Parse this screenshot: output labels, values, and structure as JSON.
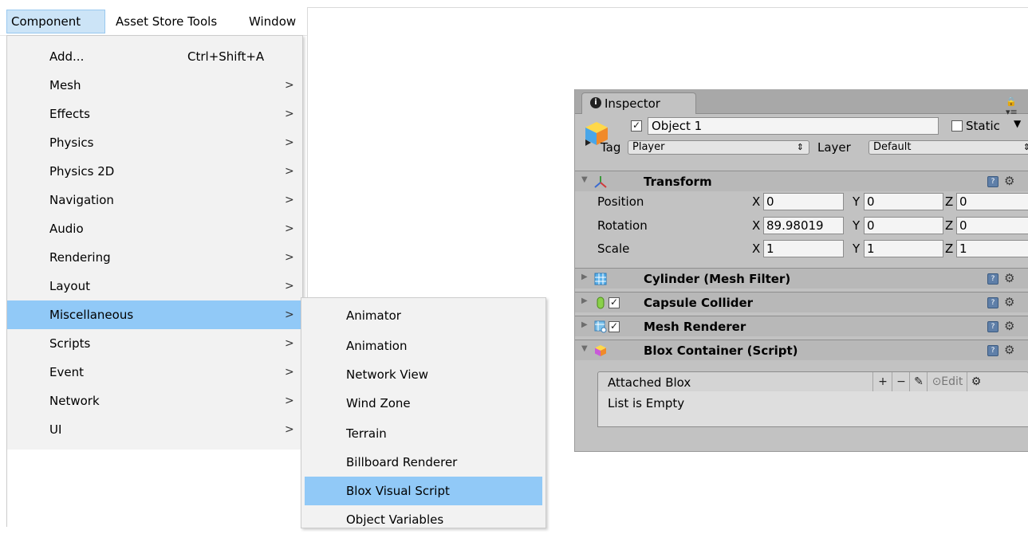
{
  "menubar": {
    "items": [
      "Component",
      "Asset Store Tools",
      "Window"
    ]
  },
  "component_menu": {
    "items": [
      {
        "label": "Add...",
        "shortcut": "Ctrl+Shift+A",
        "arrow": ""
      },
      {
        "label": "Mesh",
        "shortcut": "",
        "arrow": ">"
      },
      {
        "label": "Effects",
        "shortcut": "",
        "arrow": ">"
      },
      {
        "label": "Physics",
        "shortcut": "",
        "arrow": ">"
      },
      {
        "label": "Physics 2D",
        "shortcut": "",
        "arrow": ">"
      },
      {
        "label": "Navigation",
        "shortcut": "",
        "arrow": ">"
      },
      {
        "label": "Audio",
        "shortcut": "",
        "arrow": ">"
      },
      {
        "label": "Rendering",
        "shortcut": "",
        "arrow": ">"
      },
      {
        "label": "Layout",
        "shortcut": "",
        "arrow": ">"
      },
      {
        "label": "Miscellaneous",
        "shortcut": "",
        "arrow": ">"
      },
      {
        "label": "Scripts",
        "shortcut": "",
        "arrow": ">"
      },
      {
        "label": "Event",
        "shortcut": "",
        "arrow": ">"
      },
      {
        "label": "Network",
        "shortcut": "",
        "arrow": ">"
      },
      {
        "label": "UI",
        "shortcut": "",
        "arrow": ">"
      }
    ],
    "highlighted": "Miscellaneous"
  },
  "misc_submenu": {
    "items": [
      "Animator",
      "Animation",
      "Network View",
      "Wind Zone",
      "Terrain",
      "Billboard Renderer",
      "Blox Visual Script",
      "Object Variables"
    ],
    "highlighted": "Blox Visual Script"
  },
  "inspector": {
    "tab_title": "Inspector",
    "info_glyph": "i",
    "lock_glyph": "🔒 ▾≡",
    "object_enabled": true,
    "object_name": "Object 1",
    "static_label": "Static",
    "static_checked": false,
    "tag_label": "Tag",
    "tag_value": "Player",
    "layer_label": "Layer",
    "layer_value": "Default",
    "dropdown_arrow": "⇕",
    "transform": {
      "title": "Transform",
      "rows": [
        {
          "label": "Position",
          "x": "0",
          "y": "0",
          "z": "0"
        },
        {
          "label": "Rotation",
          "x": "89.98019",
          "y": "0",
          "z": "0"
        },
        {
          "label": "Scale",
          "x": "1",
          "y": "1",
          "z": "1"
        }
      ],
      "axes": [
        "X",
        "Y",
        "Z"
      ]
    },
    "components": [
      {
        "title": "Cylinder (Mesh Filter)",
        "has_checkbox": false,
        "icon": "mesh-filter-icon"
      },
      {
        "title": "Capsule Collider",
        "has_checkbox": true,
        "icon": "capsule-collider-icon"
      },
      {
        "title": "Mesh Renderer",
        "has_checkbox": true,
        "icon": "mesh-renderer-icon"
      }
    ],
    "blox_container": {
      "title": "Blox Container (Script)",
      "list_title": "Attached Blox",
      "buttons": [
        "+",
        "−",
        "✎",
        "⊙Edit",
        "⚙"
      ],
      "empty_text": "List is Empty"
    },
    "colors": {
      "panel_bg": "#c2c2c2",
      "header_bg": "#b8b8b8",
      "menu_highlight": "#91c9f7"
    }
  }
}
